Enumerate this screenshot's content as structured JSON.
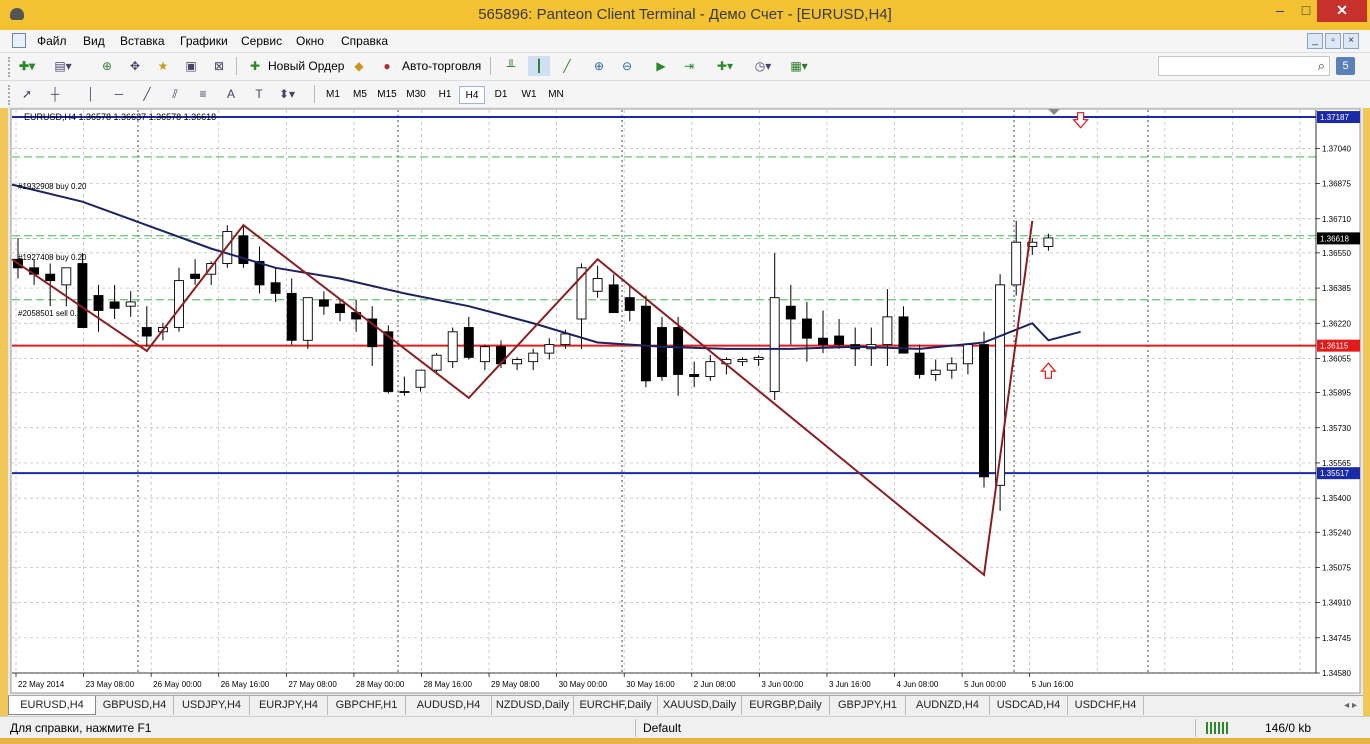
{
  "window": {
    "title": "565896: Panteon Client Terminal - Демо Счет - [EURUSD,H4]",
    "minimize": "–",
    "maximize": "□",
    "close": "✕"
  },
  "menu": [
    "Файл",
    "Вид",
    "Вставка",
    "Графики",
    "Сервис",
    "Окно",
    "Справка"
  ],
  "toolbar": {
    "new_order": "Новый Ордер",
    "auto_trading": "Авто-торговля",
    "help_badge": "5"
  },
  "timeframes": [
    "M1",
    "M5",
    "M15",
    "M30",
    "H1",
    "H4",
    "D1",
    "W1",
    "MN"
  ],
  "active_timeframe": "H4",
  "chart_header": "EURUSD,H4  1.36578 1.36637 1.36578 1.36618",
  "order_labels": {
    "o1": "#1932908 buy 0.20",
    "o2": "#1927408 buy 0.20",
    "o3": "#2058501 sell 0.20"
  },
  "chart_data": {
    "type": "candlestick",
    "symbol": "EURUSD",
    "timeframe": "H4",
    "ylim": [
      1.3458,
      1.3722
    ],
    "y_ticks": [
      "1.37040",
      "1.36875",
      "1.36710",
      "1.36550",
      "1.36385",
      "1.36220",
      "1.36055",
      "1.35895",
      "1.35730",
      "1.35565",
      "1.35400",
      "1.35240",
      "1.35075",
      "1.34910",
      "1.34745",
      "1.34580"
    ],
    "x_labels": [
      "22 May 2014",
      "23 May 08:00",
      "26 May 00:00",
      "26 May 16:00",
      "27 May 08:00",
      "28 May 00:00",
      "28 May 16:00",
      "29 May 08:00",
      "30 May 00:00",
      "30 May 16:00",
      "2 Jun 08:00",
      "3 Jun 00:00",
      "3 Jun 16:00",
      "4 Jun 08:00",
      "5 Jun 00:00",
      "5 Jun 16:00"
    ],
    "candles": [
      [
        1.3652,
        1.3662,
        1.3643,
        1.3648
      ],
      [
        1.3648,
        1.3652,
        1.364,
        1.3645
      ],
      [
        1.3645,
        1.365,
        1.363,
        1.3642
      ],
      [
        1.364,
        1.3648,
        1.363,
        1.3648
      ],
      [
        1.365,
        1.3655,
        1.3622,
        1.362
      ],
      [
        1.3635,
        1.364,
        1.3618,
        1.3628
      ],
      [
        1.3632,
        1.364,
        1.3624,
        1.3629
      ],
      [
        1.363,
        1.3637,
        1.3625,
        1.3632
      ],
      [
        1.362,
        1.363,
        1.3611,
        1.3616
      ],
      [
        1.3618,
        1.3622,
        1.3614,
        1.362
      ],
      [
        1.362,
        1.3648,
        1.3618,
        1.3642
      ],
      [
        1.3645,
        1.3652,
        1.364,
        1.3643
      ],
      [
        1.3645,
        1.3651,
        1.364,
        1.365
      ],
      [
        1.365,
        1.3668,
        1.3648,
        1.3665
      ],
      [
        1.3663,
        1.3668,
        1.3648,
        1.365
      ],
      [
        1.3651,
        1.3658,
        1.3636,
        1.364
      ],
      [
        1.3641,
        1.3648,
        1.3632,
        1.3636
      ],
      [
        1.3636,
        1.3643,
        1.3612,
        1.3614
      ],
      [
        1.3614,
        1.3634,
        1.361,
        1.3634
      ],
      [
        1.3633,
        1.3637,
        1.3626,
        1.363
      ],
      [
        1.3631,
        1.3633,
        1.3623,
        1.3627
      ],
      [
        1.3627,
        1.3633,
        1.3618,
        1.3624
      ],
      [
        1.3624,
        1.363,
        1.3602,
        1.3611
      ],
      [
        1.3618,
        1.3621,
        1.3589,
        1.359
      ],
      [
        1.359,
        1.3597,
        1.3588,
        1.359
      ],
      [
        1.3592,
        1.36,
        1.359,
        1.36
      ],
      [
        1.36,
        1.3608,
        1.3598,
        1.3607
      ],
      [
        1.3604,
        1.362,
        1.3601,
        1.3618
      ],
      [
        1.362,
        1.3625,
        1.3605,
        1.3606
      ],
      [
        1.3604,
        1.3612,
        1.36,
        1.3611
      ],
      [
        1.3611,
        1.3614,
        1.3601,
        1.3603
      ],
      [
        1.3603,
        1.3606,
        1.36,
        1.3605
      ],
      [
        1.3604,
        1.361,
        1.36,
        1.3608
      ],
      [
        1.3608,
        1.3615,
        1.3605,
        1.3612
      ],
      [
        1.3612,
        1.3619,
        1.361,
        1.3617
      ],
      [
        1.3624,
        1.365,
        1.361,
        1.3648
      ],
      [
        1.3637,
        1.3649,
        1.3634,
        1.3643
      ],
      [
        1.364,
        1.3645,
        1.363,
        1.3627
      ],
      [
        1.3634,
        1.364,
        1.3623,
        1.3628
      ],
      [
        1.363,
        1.3635,
        1.3592,
        1.3595
      ],
      [
        1.362,
        1.3625,
        1.3595,
        1.3597
      ],
      [
        1.362,
        1.3625,
        1.3588,
        1.3598
      ],
      [
        1.3598,
        1.3604,
        1.3592,
        1.3597
      ],
      [
        1.3597,
        1.3607,
        1.3595,
        1.3604
      ],
      [
        1.3603,
        1.3606,
        1.3598,
        1.3605
      ],
      [
        1.3604,
        1.3606,
        1.3602,
        1.3605
      ],
      [
        1.3605,
        1.3607,
        1.3602,
        1.3606
      ],
      [
        1.359,
        1.3655,
        1.3586,
        1.3634
      ],
      [
        1.363,
        1.364,
        1.3612,
        1.3624
      ],
      [
        1.3624,
        1.3632,
        1.3604,
        1.3615
      ],
      [
        1.3615,
        1.3628,
        1.3608,
        1.3612
      ],
      [
        1.3616,
        1.3624,
        1.361,
        1.3612
      ],
      [
        1.3612,
        1.362,
        1.3602,
        1.361
      ],
      [
        1.361,
        1.362,
        1.3602,
        1.3612
      ],
      [
        1.3612,
        1.3638,
        1.3602,
        1.3625
      ],
      [
        1.3625,
        1.363,
        1.3608,
        1.3608
      ],
      [
        1.3608,
        1.3612,
        1.3596,
        1.3598
      ],
      [
        1.3598,
        1.3605,
        1.3595,
        1.36
      ],
      [
        1.36,
        1.3606,
        1.3596,
        1.3603
      ],
      [
        1.3603,
        1.3612,
        1.3598,
        1.3612
      ],
      [
        1.3612,
        1.3618,
        1.3545,
        1.355
      ],
      [
        1.3546,
        1.3645,
        1.3534,
        1.364
      ],
      [
        1.364,
        1.367,
        1.3635,
        1.366
      ],
      [
        1.3658,
        1.3662,
        1.3654,
        1.366
      ],
      [
        1.3658,
        1.3664,
        1.3656,
        1.3662
      ]
    ],
    "ma_points": [
      [
        0,
        1.3687
      ],
      [
        4,
        1.3679
      ],
      [
        8,
        1.3668
      ],
      [
        12,
        1.3657
      ],
      [
        16,
        1.3648
      ],
      [
        20,
        1.3643
      ],
      [
        24,
        1.3636
      ],
      [
        28,
        1.363
      ],
      [
        32,
        1.3622
      ],
      [
        36,
        1.3613
      ],
      [
        40,
        1.3611
      ],
      [
        44,
        1.361
      ],
      [
        48,
        1.361
      ],
      [
        52,
        1.3611
      ],
      [
        56,
        1.361
      ],
      [
        60,
        1.3613
      ],
      [
        63,
        1.3622
      ],
      [
        64,
        1.3614
      ],
      [
        66,
        1.3618
      ]
    ],
    "zigzag_points": [
      [
        0,
        1.3652
      ],
      [
        8,
        1.3609
      ],
      [
        14,
        1.3668
      ],
      [
        28,
        1.3587
      ],
      [
        36,
        1.3652
      ],
      [
        60,
        1.3504
      ],
      [
        63,
        1.367
      ]
    ],
    "levels": [
      {
        "label": "1.37187",
        "value": 1.37187,
        "color": "#1a2aa8",
        "style": "solid"
      },
      {
        "label": "1.36115",
        "value": 1.36115,
        "color": "#e31b1b",
        "style": "solid"
      },
      {
        "label": "1.35517",
        "value": 1.35517,
        "color": "#1a2aa8",
        "style": "solid"
      },
      {
        "label": "1.36618",
        "value": 1.36618,
        "color": "#000000",
        "style": "price"
      }
    ],
    "orders": [
      {
        "value": 1.37,
        "color": "#2fa83a"
      },
      {
        "value": 1.3663,
        "color": "#2fa83a"
      },
      {
        "value": 1.3633,
        "color": "#2fa83a"
      }
    ],
    "arrows": [
      {
        "index": 66,
        "value": 1.3717,
        "dir": "down"
      },
      {
        "index": 64,
        "value": 1.36,
        "dir": "up"
      }
    ],
    "colors": {
      "bg": "#ffffff",
      "grid": "#b9b9b9",
      "bull": "#ffffff",
      "bear": "#000000",
      "ma": "#1b2360",
      "zigzag": "#8b1f1f"
    }
  },
  "tabs": [
    "EURUSD,H4",
    "GBPUSD,H4",
    "USDJPY,H4",
    "EURJPY,H4",
    "GBPCHF,H1",
    "AUDUSD,H4",
    "NZDUSD,Daily",
    "EURCHF,Daily",
    "XAUUSD,Daily",
    "EURGBP,Daily",
    "GBPJPY,H1",
    "AUDNZD,H4",
    "USDCAD,H4",
    "USDCHF,H4"
  ],
  "active_tab": "EURUSD,H4",
  "tab_scroll": "◂ ▸",
  "status": {
    "help": "Для справки, нажмите F1",
    "profile": "Default",
    "traffic": "146/0 kb"
  }
}
